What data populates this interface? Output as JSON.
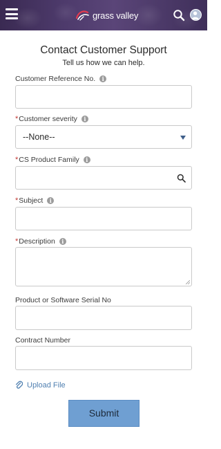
{
  "header": {
    "brand": "grass valley",
    "menu_icon": "hamburger-menu-icon",
    "logo_icon": "grass-valley-logo-icon",
    "search_icon": "search-icon",
    "avatar_icon": "user-avatar-icon",
    "background_color": "#4a3866"
  },
  "page": {
    "title": "Contact Customer Support",
    "subtitle": "Tell us how we can help."
  },
  "form": {
    "customer_reference": {
      "label": "Customer Reference No.",
      "value": ""
    },
    "customer_severity": {
      "required": "*",
      "label": "Customer severity",
      "selected": "--None--"
    },
    "cs_product_family": {
      "required": "*",
      "label": "CS Product Family",
      "value": "",
      "icon": "search-icon"
    },
    "subject": {
      "required": "*",
      "label": "Subject",
      "value": ""
    },
    "description": {
      "required": "*",
      "label": "Description",
      "value": ""
    },
    "serial_no": {
      "label": "Product or Software Serial No",
      "value": ""
    },
    "contract_number": {
      "label": "Contract Number",
      "value": ""
    },
    "info_icon": "info-icon",
    "upload": {
      "label": "Upload File",
      "icon": "paperclip-icon"
    },
    "submit_label": "Submit"
  },
  "colors": {
    "required": "#c23934",
    "link": "#4f7fb0",
    "submit_bg": "#6f9fd2"
  }
}
